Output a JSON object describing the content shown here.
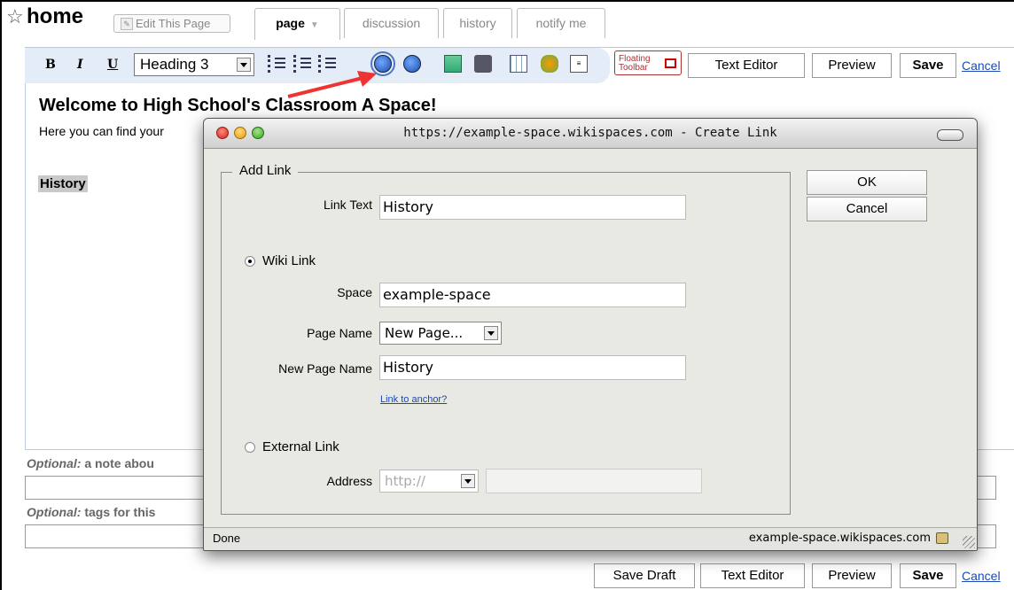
{
  "header": {
    "page_title": "home",
    "edit_button": "Edit This Page",
    "tabs": [
      {
        "label": "page"
      },
      {
        "label": "discussion"
      },
      {
        "label": "history"
      },
      {
        "label": "notify me"
      }
    ]
  },
  "toolbar": {
    "bold": "B",
    "italic": "I",
    "underline": "U",
    "style_select": "Heading 3",
    "floating_toolbar": "Floating Toolbar",
    "text_editor": "Text Editor",
    "preview": "Preview",
    "save": "Save",
    "cancel": "Cancel"
  },
  "document": {
    "title": "Welcome to High School's Classroom A Space!",
    "line": "Here you can find your",
    "history_text": "History"
  },
  "bottom": {
    "note_label_italic": "Optional:",
    "note_label_rest": "a note abou",
    "tags_label_italic": "Optional:",
    "tags_label_rest": "tags for this",
    "save_draft": "Save Draft",
    "text_editor": "Text Editor",
    "preview": "Preview",
    "save": "Save",
    "cancel": "Cancel"
  },
  "dialog": {
    "title": "https://example-space.wikispaces.com - Create Link",
    "legend": "Add Link",
    "link_text_label": "Link Text",
    "link_text_value": "History",
    "wiki_link_label": "Wiki Link",
    "space_label": "Space",
    "space_value": "example-space",
    "page_name_label": "Page Name",
    "page_name_value": "New Page...",
    "new_page_name_label": "New Page Name",
    "new_page_name_value": "History",
    "anchor_link": "Link to anchor?",
    "external_link_label": "External Link",
    "address_label": "Address",
    "address_protocol": "http://",
    "address_value": "",
    "ok": "OK",
    "cancel": "Cancel",
    "status": "Done",
    "status_host": "example-space.wikispaces.com"
  }
}
